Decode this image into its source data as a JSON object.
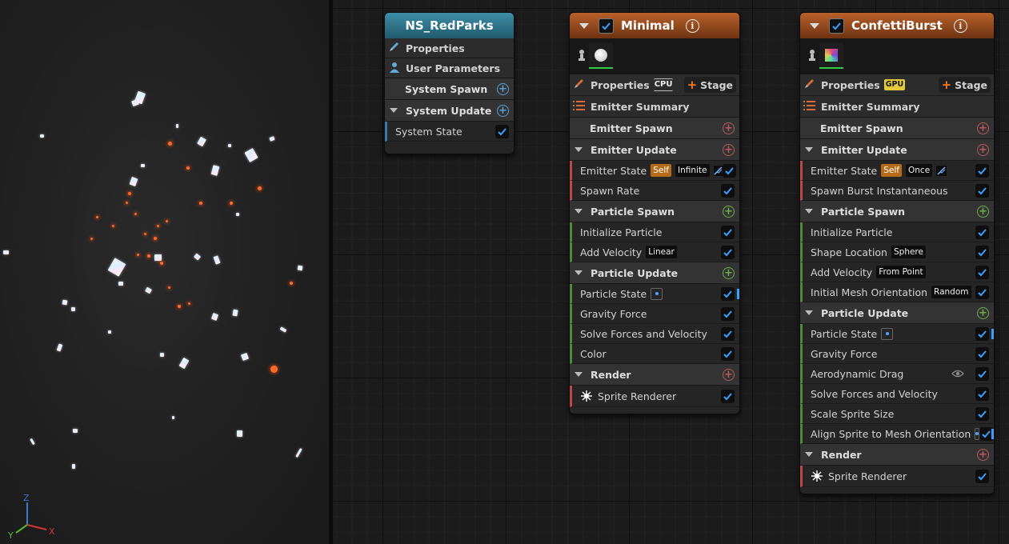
{
  "viewport": {
    "axes": {
      "z": "Z",
      "y": "Y",
      "x": "X"
    },
    "colors": {
      "x": "#d43434",
      "y": "#58b434",
      "z": "#3a7ad0"
    }
  },
  "system_node": {
    "title": "NS_RedParks",
    "rows": {
      "properties": "Properties",
      "user_parameters": "User Parameters",
      "system_spawn": "System Spawn",
      "system_update": "System Update",
      "system_state": "System State"
    }
  },
  "emitters": [
    {
      "title": "Minimal",
      "properties": "Properties",
      "sim_target": "CPU",
      "stage": "Stage",
      "summary": "Emitter Summary",
      "emitter_spawn": "Emitter Spawn",
      "emitter_update": "Emitter Update",
      "emitter_update_items": [
        {
          "label": "Emitter State",
          "tags": [
            "Self",
            "Infinite"
          ]
        },
        {
          "label": "Spawn Rate",
          "tags": []
        }
      ],
      "particle_spawn": "Particle Spawn",
      "particle_spawn_items": [
        {
          "label": "Initialize Particle",
          "tags": []
        },
        {
          "label": "Add Velocity",
          "tags": [
            "Linear"
          ]
        }
      ],
      "particle_update": "Particle Update",
      "particle_update_items": [
        {
          "label": "Particle State",
          "tags": []
        },
        {
          "label": "Gravity Force",
          "tags": []
        },
        {
          "label": "Solve Forces and Velocity",
          "tags": []
        },
        {
          "label": "Color",
          "tags": []
        }
      ],
      "render": "Render",
      "render_items": [
        {
          "label": "Sprite Renderer"
        }
      ]
    },
    {
      "title": "ConfettiBurst",
      "properties": "Properties",
      "sim_target": "GPU",
      "stage": "Stage",
      "summary": "Emitter Summary",
      "emitter_spawn": "Emitter Spawn",
      "emitter_update": "Emitter Update",
      "emitter_update_items": [
        {
          "label": "Emitter State",
          "tags": [
            "Self",
            "Once"
          ]
        },
        {
          "label": "Spawn Burst Instantaneous",
          "tags": []
        }
      ],
      "particle_spawn": "Particle Spawn",
      "particle_spawn_items": [
        {
          "label": "Initialize Particle",
          "tags": []
        },
        {
          "label": "Shape Location",
          "tags": [
            "Sphere"
          ]
        },
        {
          "label": "Add Velocity",
          "tags": [
            "From Point"
          ]
        },
        {
          "label": "Initial Mesh Orientation",
          "tags": [
            "Random"
          ]
        }
      ],
      "particle_update": "Particle Update",
      "particle_update_items": [
        {
          "label": "Particle State",
          "tags": []
        },
        {
          "label": "Gravity Force",
          "tags": []
        },
        {
          "label": "Aerodynamic Drag",
          "tags": []
        },
        {
          "label": "Solve Forces and Velocity",
          "tags": []
        },
        {
          "label": "Scale Sprite Size",
          "tags": []
        },
        {
          "label": "Align Sprite to Mesh Orientation",
          "tags": []
        }
      ],
      "render": "Render",
      "render_items": [
        {
          "label": "Sprite Renderer"
        }
      ]
    }
  ],
  "colors": {
    "system_header": "#2f7b93",
    "emitter_header": "#9c5022",
    "checkbox_check": "#3aa0ff",
    "sim_gpu_badge": "#e4c93a",
    "self_tag": "#b56b18"
  }
}
